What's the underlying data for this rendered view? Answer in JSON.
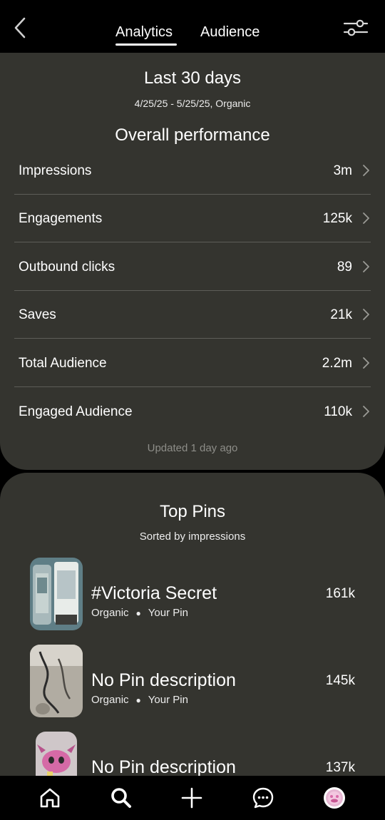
{
  "header": {
    "tabs": [
      {
        "label": "Analytics",
        "active": true
      },
      {
        "label": "Audience",
        "active": false
      }
    ],
    "icons": {
      "back": "chevron-left-icon",
      "filter": "sliders-icon"
    }
  },
  "overview": {
    "title": "Last 30 days",
    "subtitle": "4/25/25 - 5/25/25, Organic",
    "section_title": "Overall performance",
    "metrics": [
      {
        "label": "Impressions",
        "value": "3m"
      },
      {
        "label": "Engagements",
        "value": "125k"
      },
      {
        "label": "Outbound clicks",
        "value": "89"
      },
      {
        "label": "Saves",
        "value": "21k"
      },
      {
        "label": "Total Audience",
        "value": "2.2m"
      },
      {
        "label": "Engaged Audience",
        "value": "110k"
      }
    ],
    "updated": "Updated 1 day ago"
  },
  "top_pins": {
    "title": "Top Pins",
    "subtitle": "Sorted by impressions",
    "pins": [
      {
        "title": "#Victoria Secret",
        "source": "Organic",
        "owner": "Your Pin",
        "count": "161k"
      },
      {
        "title": "No Pin description",
        "source": "Organic",
        "owner": "Your Pin",
        "count": "145k"
      },
      {
        "title": "No Pin description",
        "source": "",
        "owner": "",
        "count": "137k"
      }
    ]
  },
  "bottom_nav": [
    {
      "icon": "home-icon"
    },
    {
      "icon": "search-icon"
    },
    {
      "icon": "plus-icon"
    },
    {
      "icon": "messages-icon"
    },
    {
      "icon": "profile-avatar-icon"
    }
  ],
  "colors": {
    "background": "#000000",
    "card": "#34342f",
    "divider": "#5d5d58",
    "muted_text": "#8d8d88",
    "text": "#ffffff"
  }
}
